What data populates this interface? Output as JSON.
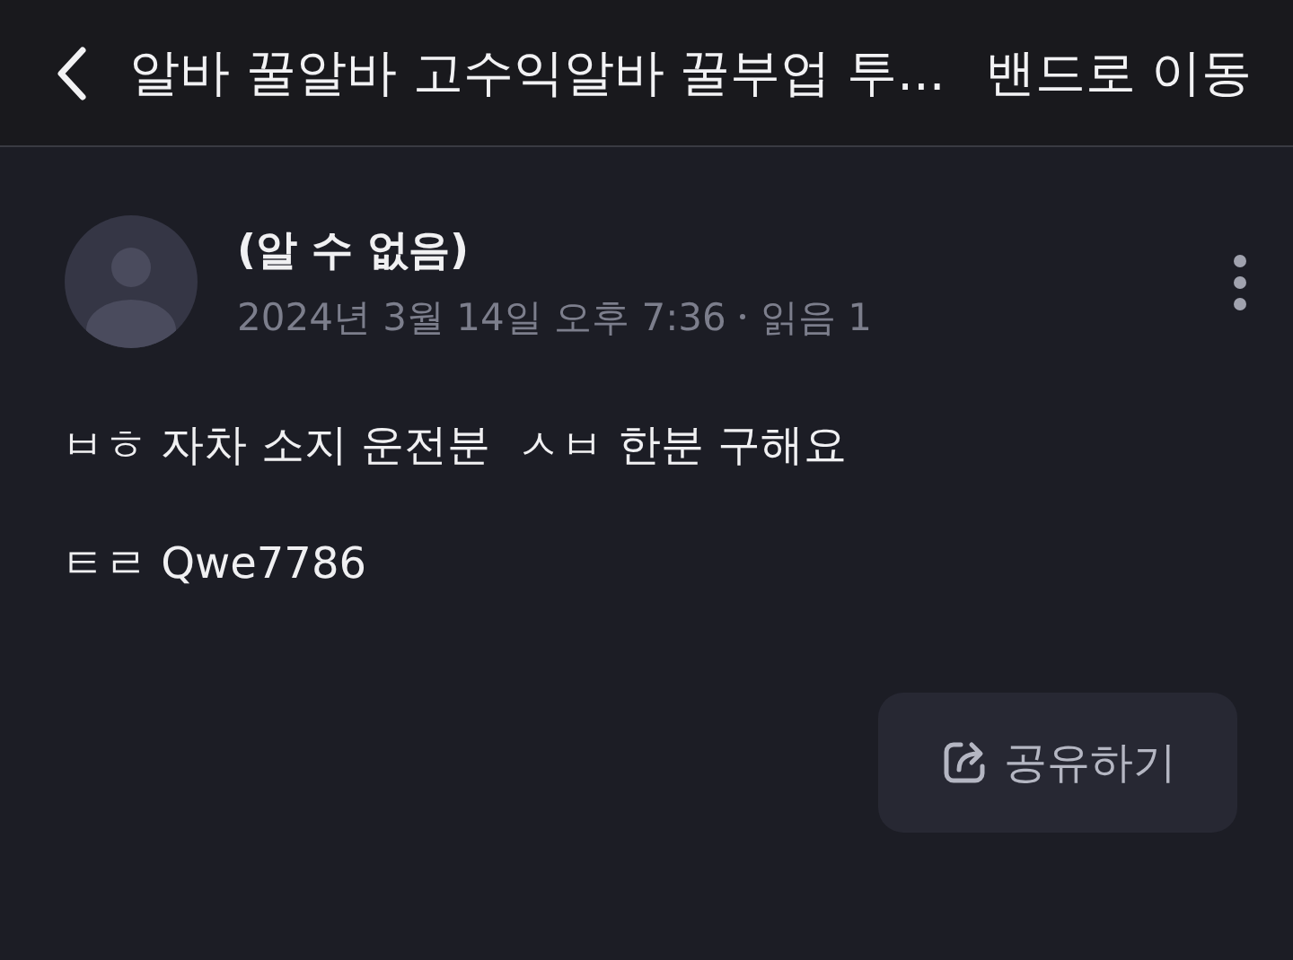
{
  "header": {
    "title": "알바 꿀알바 고수익알바 꿀부업 투...",
    "action": "밴드로 이동"
  },
  "post": {
    "author": "(알 수 없음)",
    "date": "2024년 3월 14일 오후 7:36",
    "reads": "읽음 1",
    "paragraphs": [
      "ㅂㅎ 자차 소지 운전분  ㅅㅂ 한분 구해요",
      "ㅌㄹ Qwe7786"
    ]
  },
  "share_button": "공유하기"
}
